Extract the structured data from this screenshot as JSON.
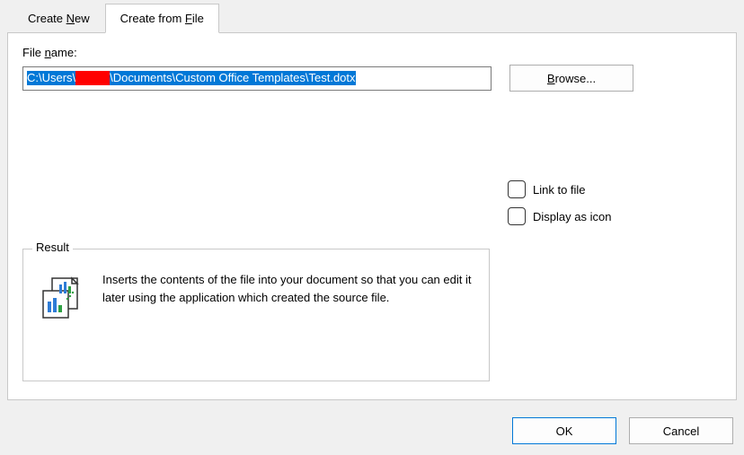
{
  "tabs": {
    "create_new_pre": "Create ",
    "create_new_u": "N",
    "create_new_post": "ew",
    "create_from_file_pre": "Create from ",
    "create_from_file_u": "F",
    "create_from_file_post": "ile"
  },
  "file": {
    "label_pre": "File ",
    "label_u": "n",
    "label_post": "ame:",
    "value_pre": "C:\\Users\\",
    "value_post": "\\Documents\\Custom Office Templates\\Test.dotx",
    "browse_u": "B",
    "browse_post": "rowse..."
  },
  "options": {
    "link_label": "Link to file",
    "display_icon_label": "Display as icon"
  },
  "result": {
    "legend": "Result",
    "text": "Inserts the contents of the file into your document so that you can edit it later using the application which created the source file."
  },
  "buttons": {
    "ok": "OK",
    "cancel": "Cancel"
  }
}
